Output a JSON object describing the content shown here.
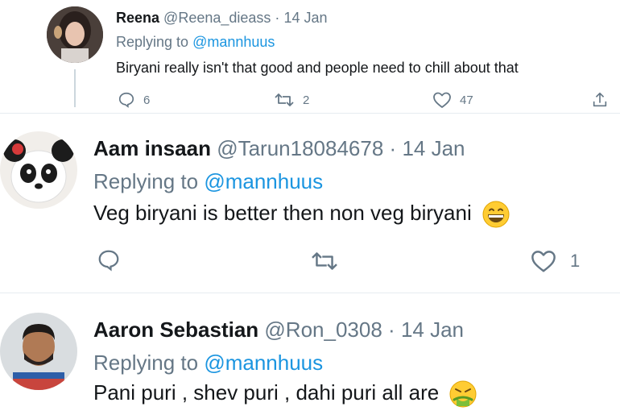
{
  "colors": {
    "accent": "#1b95e0",
    "secondary": "#657786",
    "text": "#14171a",
    "divider": "#e6ecf0"
  },
  "tweets": [
    {
      "name": "Reena",
      "handle": "@Reena_dieass",
      "separator": "·",
      "date": "14 Jan",
      "replying_prefix": "Replying to",
      "replying_to": "@mannhuus",
      "text": "Biryani really isn't that good and people need to chill about that",
      "reply_count": "6",
      "retweet_count": "2",
      "like_count": "47",
      "icons": [
        "reply-icon",
        "retweet-icon",
        "heart-icon",
        "share-icon"
      ]
    },
    {
      "name": "Aam insaan",
      "handle": "@Tarun18084678",
      "separator": "·",
      "date": "14 Jan",
      "replying_prefix": "Replying to",
      "replying_to": "@mannhuus",
      "text": "Veg biryani is better then non veg biryani",
      "emoji": "grinning-face-emoji",
      "reply_count": "",
      "retweet_count": "",
      "like_count": "1",
      "icons": [
        "reply-icon",
        "retweet-icon",
        "heart-icon"
      ]
    },
    {
      "name": "Aaron Sebastian",
      "handle": "@Ron_0308",
      "separator": "·",
      "date": "14 Jan",
      "replying_prefix": "Replying to",
      "replying_to": "@mannhuus",
      "text": "Pani puri , shev puri , dahi puri all are",
      "emoji": "nauseated-face-emoji"
    }
  ]
}
